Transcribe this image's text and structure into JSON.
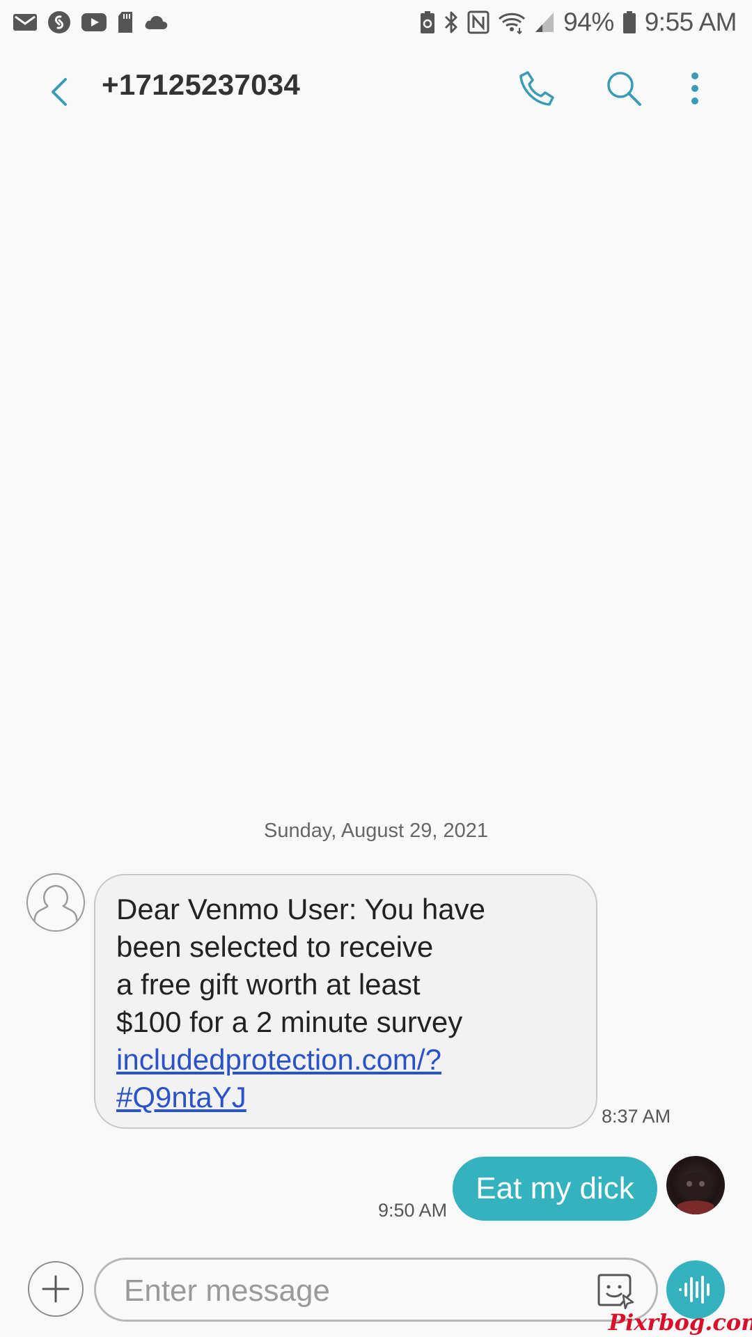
{
  "status_bar": {
    "left_icons": [
      "mail-icon",
      "shazam-icon",
      "youtube-icon",
      "sd-card-icon",
      "cloud-icon"
    ],
    "right_icons": [
      "battery-saver-icon",
      "bluetooth-icon",
      "nfc-icon",
      "wifi-icon",
      "signal-icon",
      "battery-icon"
    ],
    "battery": "94%",
    "time": "9:55 AM"
  },
  "header": {
    "contact": "+17125237034",
    "icons": [
      "back-icon",
      "phone-icon",
      "search-icon",
      "more-vert-icon"
    ]
  },
  "conversation": {
    "date": "Sunday, August 29, 2021",
    "incoming": {
      "lines": [
        "Dear Venmo User: You have",
        "been selected to receive",
        "a free gift worth at least",
        "$100 for a 2 minute survey"
      ],
      "link_lines": [
        "includedprotection.com/?",
        "#Q9ntaYJ"
      ],
      "time": "8:37 AM"
    },
    "outgoing": {
      "text": "Eat my dick",
      "time": "9:50 AM"
    }
  },
  "composer": {
    "placeholder": "Enter message",
    "value": "",
    "icons": [
      "add-icon",
      "sticker-icon",
      "voice-icon"
    ]
  },
  "watermark": "Pixrbog.com",
  "colors": {
    "accent": "#34b3bf",
    "link": "#2a52c9",
    "background": "#f9f9f9",
    "watermark": "#d8102a"
  }
}
